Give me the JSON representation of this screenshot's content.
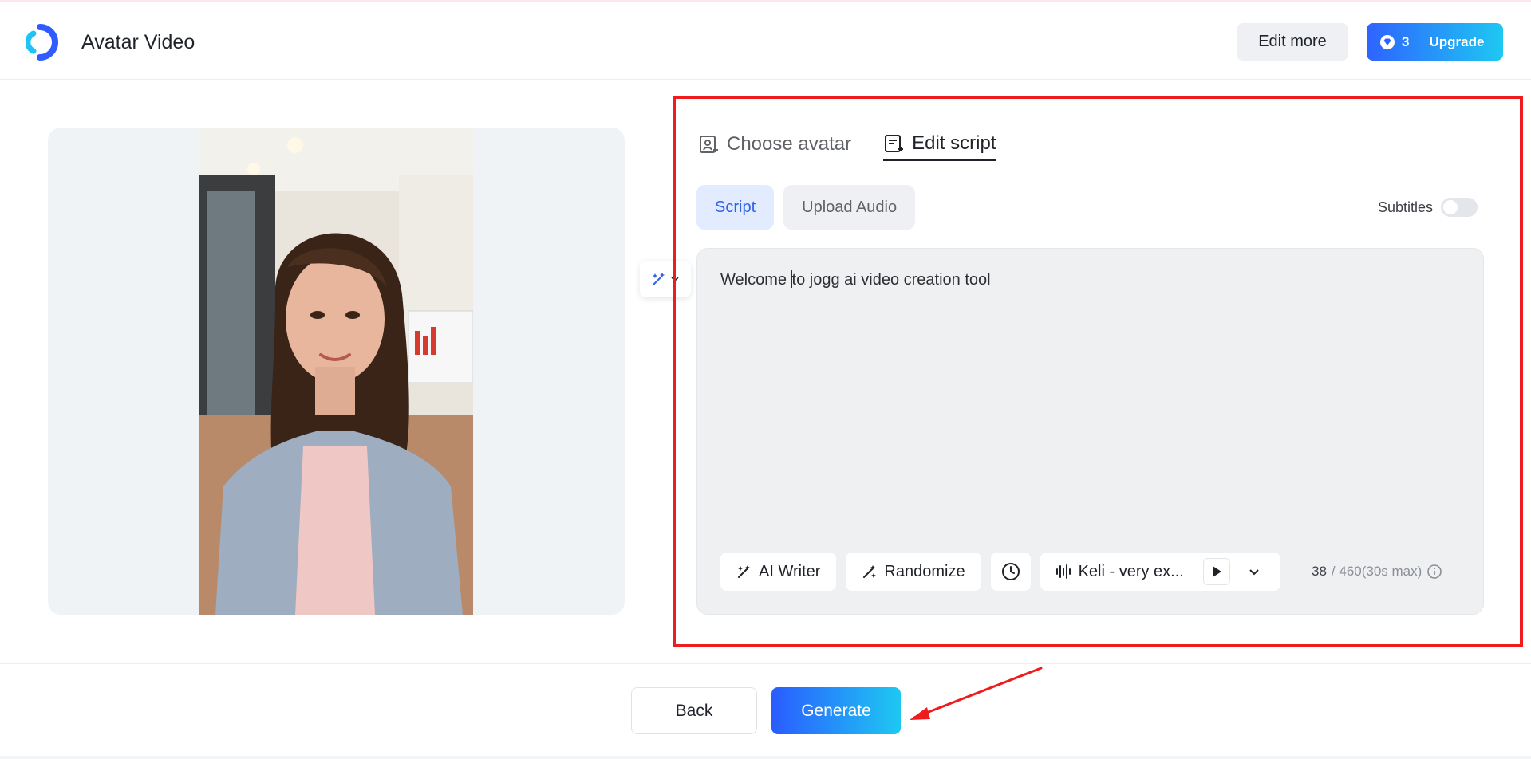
{
  "header": {
    "title": "Avatar Video",
    "edit_more_label": "Edit more",
    "credits": "3",
    "upgrade_label": "Upgrade"
  },
  "tabs": [
    {
      "label": "Choose avatar",
      "icon": "avatar-icon",
      "active": false
    },
    {
      "label": "Edit script",
      "icon": "script-icon",
      "active": true
    }
  ],
  "script_modes": [
    {
      "label": "Script",
      "active": true
    },
    {
      "label": "Upload Audio",
      "active": false
    }
  ],
  "subtitles": {
    "label": "Subtitles",
    "enabled": false
  },
  "editor": {
    "text_before_caret": "Welcome ",
    "text_after_caret": "to jogg ai video creation tool"
  },
  "toolbar": {
    "ai_writer_label": "AI Writer",
    "randomize_label": "Randomize",
    "voice_name": "Keli - very ex...",
    "char_count": "38",
    "char_limit": "/ 460(30s max)"
  },
  "footer": {
    "back_label": "Back",
    "generate_label": "Generate"
  },
  "colors": {
    "accent": "#2f62ee",
    "gradient_start": "#2a5cff",
    "gradient_end": "#1ec8f2",
    "highlight": "#ee1c1c"
  }
}
